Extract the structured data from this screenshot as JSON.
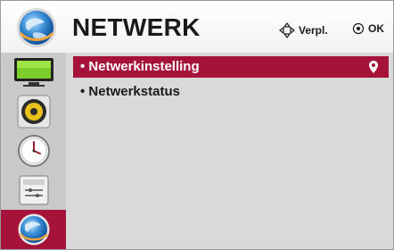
{
  "header": {
    "title": "NETWERK",
    "move_hint": "Verpl.",
    "ok_hint": "OK"
  },
  "sidebar": {
    "categories": [
      {
        "icon": "picture-icon",
        "active": false
      },
      {
        "icon": "audio-icon",
        "active": false
      },
      {
        "icon": "clock-icon",
        "active": false
      },
      {
        "icon": "options-icon",
        "active": false
      },
      {
        "icon": "network-globe-icon",
        "active": true
      }
    ]
  },
  "menu": {
    "items": [
      {
        "label": "• Netwerkinstelling",
        "selected": true
      },
      {
        "label": "• Netwerkstatus",
        "selected": false
      }
    ]
  },
  "colors": {
    "accent": "#a5133a",
    "sidebar_bg": "#c9c9c9",
    "content_bg": "#d9d9d9"
  }
}
